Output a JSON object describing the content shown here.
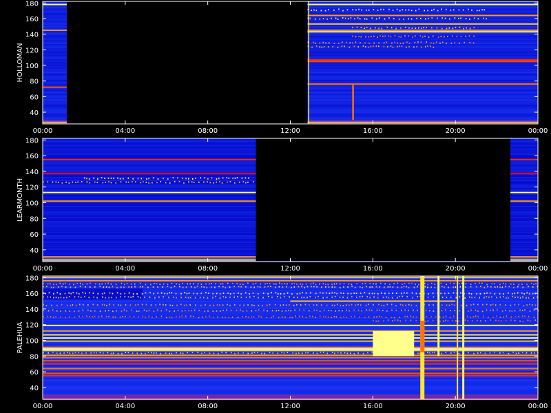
{
  "chart_data": [
    {
      "type": "heatmap",
      "ylabel": "HOLLOMAN",
      "x_ticks": [
        "00:00",
        "04:00",
        "08:00",
        "12:00",
        "16:00",
        "20:00",
        "00:00"
      ],
      "y_ticks": [
        40,
        60,
        80,
        100,
        120,
        140,
        160,
        180
      ],
      "xlim": [
        "00:00",
        "24:00"
      ],
      "ylim": [
        25,
        182
      ],
      "background_level": 0.25,
      "data_gaps": [
        [
          "01:10",
          "12:50"
        ]
      ],
      "dropouts": [],
      "continuous_lines": [
        {
          "freq": 178,
          "level": 0.85,
          "start": "00:00",
          "end": "24:00"
        },
        {
          "freq": 164,
          "level": 0.7,
          "start": "12:50",
          "end": "24:00"
        },
        {
          "freq": 153,
          "level": 0.75,
          "start": "12:50",
          "end": "24:00"
        },
        {
          "freq": 145,
          "level": 0.7,
          "start": "00:00",
          "end": "24:00"
        },
        {
          "freq": 143,
          "level": 0.9,
          "start": "12:50",
          "end": "24:00"
        },
        {
          "freq": 107,
          "level": 0.55,
          "start": "12:50",
          "end": "24:00"
        },
        {
          "freq": 105,
          "level": 0.6,
          "start": "12:50",
          "end": "24:00"
        },
        {
          "freq": 76,
          "level": 0.65,
          "start": "12:50",
          "end": "24:00"
        },
        {
          "freq": 72,
          "level": 0.6,
          "start": "00:00",
          "end": "01:10"
        },
        {
          "freq": 27,
          "level": 0.75,
          "start": "00:00",
          "end": "24:00"
        }
      ],
      "dotted_lines": [
        {
          "freq": 171,
          "level": 0.85,
          "start": "12:50",
          "end": "21:30"
        },
        {
          "freq": 160,
          "level": 0.8,
          "start": "12:50",
          "end": "21:30"
        },
        {
          "freq": 148,
          "level": 0.75,
          "start": "15:00",
          "end": "21:00"
        },
        {
          "freq": 137,
          "level": 0.7,
          "start": "15:00",
          "end": "21:00"
        },
        {
          "freq": 129,
          "level": 0.7,
          "start": "12:50",
          "end": "21:00"
        },
        {
          "freq": 124,
          "level": 0.7,
          "start": "12:50",
          "end": "19:00"
        }
      ],
      "vertical_events": [
        {
          "start": "12:52",
          "end": "12:54",
          "freq_min": 25,
          "freq_max": 182,
          "level": 0.8
        },
        {
          "start": "15:00",
          "end": "15:05",
          "freq_min": 30,
          "freq_max": 75,
          "level": 0.65
        }
      ],
      "color_scale": [
        "#000000",
        "#0000c0",
        "#2040ff",
        "#ff0000",
        "#ff8000",
        "#ffff40",
        "#ffffff"
      ]
    },
    {
      "type": "heatmap",
      "ylabel": "LEARMONTH",
      "x_ticks": [
        "00:00",
        "04:00",
        "08:00",
        "12:00",
        "16:00",
        "20:00",
        "00:00"
      ],
      "y_ticks": [
        40,
        60,
        80,
        100,
        120,
        140,
        160,
        180
      ],
      "xlim": [
        "00:00",
        "24:00"
      ],
      "ylim": [
        25,
        182
      ],
      "background_level": 0.22,
      "data_gaps": [
        [
          "10:20",
          "22:40"
        ]
      ],
      "dropouts": [],
      "continuous_lines": [
        {
          "freq": 155,
          "level": 0.55,
          "start": "00:00",
          "end": "24:00"
        },
        {
          "freq": 137,
          "level": 0.5,
          "start": "00:00",
          "end": "24:00"
        },
        {
          "freq": 113,
          "level": 0.85,
          "start": "00:00",
          "end": "24:00"
        },
        {
          "freq": 102,
          "level": 0.7,
          "start": "00:00",
          "end": "24:00"
        },
        {
          "freq": 31,
          "level": 0.7,
          "start": "00:00",
          "end": "24:00"
        },
        {
          "freq": 27,
          "level": 0.8,
          "start": "00:00",
          "end": "24:00"
        }
      ],
      "dotted_lines": [
        {
          "freq": 131,
          "level": 0.8,
          "start": "02:00",
          "end": "10:00"
        },
        {
          "freq": 126,
          "level": 0.75,
          "start": "00:00",
          "end": "10:20"
        }
      ],
      "vertical_events": [],
      "color_scale": [
        "#000000",
        "#0000c0",
        "#2040ff",
        "#ff0000",
        "#ff8000",
        "#ffff40",
        "#ffffff"
      ]
    },
    {
      "type": "heatmap",
      "ylabel": "PALEHUA",
      "x_ticks": [
        "00:00",
        "04:00",
        "08:00",
        "12:00",
        "16:00",
        "20:00",
        "00:00"
      ],
      "y_ticks": [
        40,
        60,
        80,
        100,
        120,
        140,
        160,
        180
      ],
      "xlim": [
        "00:00",
        "24:00"
      ],
      "ylim": [
        25,
        182
      ],
      "background_level": 0.28,
      "data_gaps": [],
      "dropouts": [
        {
          "start": "00:00",
          "end": "04:50",
          "freq_min": 152,
          "freq_max": 166,
          "level": 0.2
        }
      ],
      "continuous_lines": [
        {
          "freq": 180,
          "level": 0.75,
          "start": "00:00",
          "end": "24:00"
        },
        {
          "freq": 176,
          "level": 0.7,
          "start": "00:00",
          "end": "24:00"
        },
        {
          "freq": 150,
          "level": 0.75,
          "start": "12:00",
          "end": "20:00"
        },
        {
          "freq": 119,
          "level": 0.85,
          "start": "00:00",
          "end": "24:00"
        },
        {
          "freq": 112,
          "level": 0.7,
          "start": "00:00",
          "end": "24:00"
        },
        {
          "freq": 107,
          "level": 0.8,
          "start": "00:00",
          "end": "24:00"
        },
        {
          "freq": 103,
          "level": 0.9,
          "start": "00:00",
          "end": "24:00"
        },
        {
          "freq": 99,
          "level": 0.75,
          "start": "00:00",
          "end": "24:00"
        },
        {
          "freq": 91,
          "level": 0.7,
          "start": "00:00",
          "end": "24:00"
        },
        {
          "freq": 89,
          "level": 0.95,
          "start": "00:00",
          "end": "24:00"
        },
        {
          "freq": 87,
          "level": 0.8,
          "start": "00:00",
          "end": "24:00"
        },
        {
          "freq": 81,
          "level": 0.7,
          "start": "00:00",
          "end": "24:00"
        },
        {
          "freq": 78,
          "level": 0.65,
          "start": "00:00",
          "end": "24:00"
        },
        {
          "freq": 74,
          "level": 0.6,
          "start": "00:00",
          "end": "24:00"
        },
        {
          "freq": 70,
          "level": 0.55,
          "start": "00:00",
          "end": "24:00"
        },
        {
          "freq": 64,
          "level": 0.65,
          "start": "00:00",
          "end": "24:00"
        },
        {
          "freq": 58,
          "level": 0.6,
          "start": "00:00",
          "end": "24:00"
        },
        {
          "freq": 55,
          "level": 0.55,
          "start": "00:00",
          "end": "24:00"
        }
      ],
      "dotted_lines": [
        {
          "freq": 172,
          "level": 0.7,
          "start": "00:00",
          "end": "24:00"
        },
        {
          "freq": 168,
          "level": 0.75,
          "start": "00:00",
          "end": "24:00"
        },
        {
          "freq": 160,
          "level": 0.8,
          "start": "00:00",
          "end": "24:00"
        },
        {
          "freq": 155,
          "level": 0.75,
          "start": "00:00",
          "end": "24:00"
        },
        {
          "freq": 145,
          "level": 0.7,
          "start": "00:00",
          "end": "24:00"
        },
        {
          "freq": 138,
          "level": 0.7,
          "start": "00:00",
          "end": "24:00"
        },
        {
          "freq": 130,
          "level": 0.65,
          "start": "00:00",
          "end": "24:00"
        },
        {
          "freq": 125,
          "level": 0.65,
          "start": "16:00",
          "end": "24:00"
        },
        {
          "freq": 84,
          "level": 0.75,
          "start": "00:00",
          "end": "24:00"
        }
      ],
      "vertical_events": [
        {
          "start": "16:00",
          "end": "18:00",
          "freq_min": 80,
          "freq_max": 112,
          "level": 0.9
        },
        {
          "start": "18:18",
          "end": "18:30",
          "freq_min": 25,
          "freq_max": 182,
          "level": 0.8
        },
        {
          "start": "18:18",
          "end": "18:30",
          "freq_min": 85,
          "freq_max": 125,
          "level": 0.65
        },
        {
          "start": "19:08",
          "end": "19:14",
          "freq_min": 80,
          "freq_max": 182,
          "level": 0.85
        },
        {
          "start": "20:04",
          "end": "20:08",
          "freq_min": 25,
          "freq_max": 182,
          "level": 0.8
        },
        {
          "start": "20:20",
          "end": "20:26",
          "freq_min": 25,
          "freq_max": 182,
          "level": 0.85
        }
      ],
      "color_scale": [
        "#000000",
        "#0000c0",
        "#2040ff",
        "#ff0000",
        "#ff8000",
        "#ffff40",
        "#ffffff"
      ]
    }
  ]
}
